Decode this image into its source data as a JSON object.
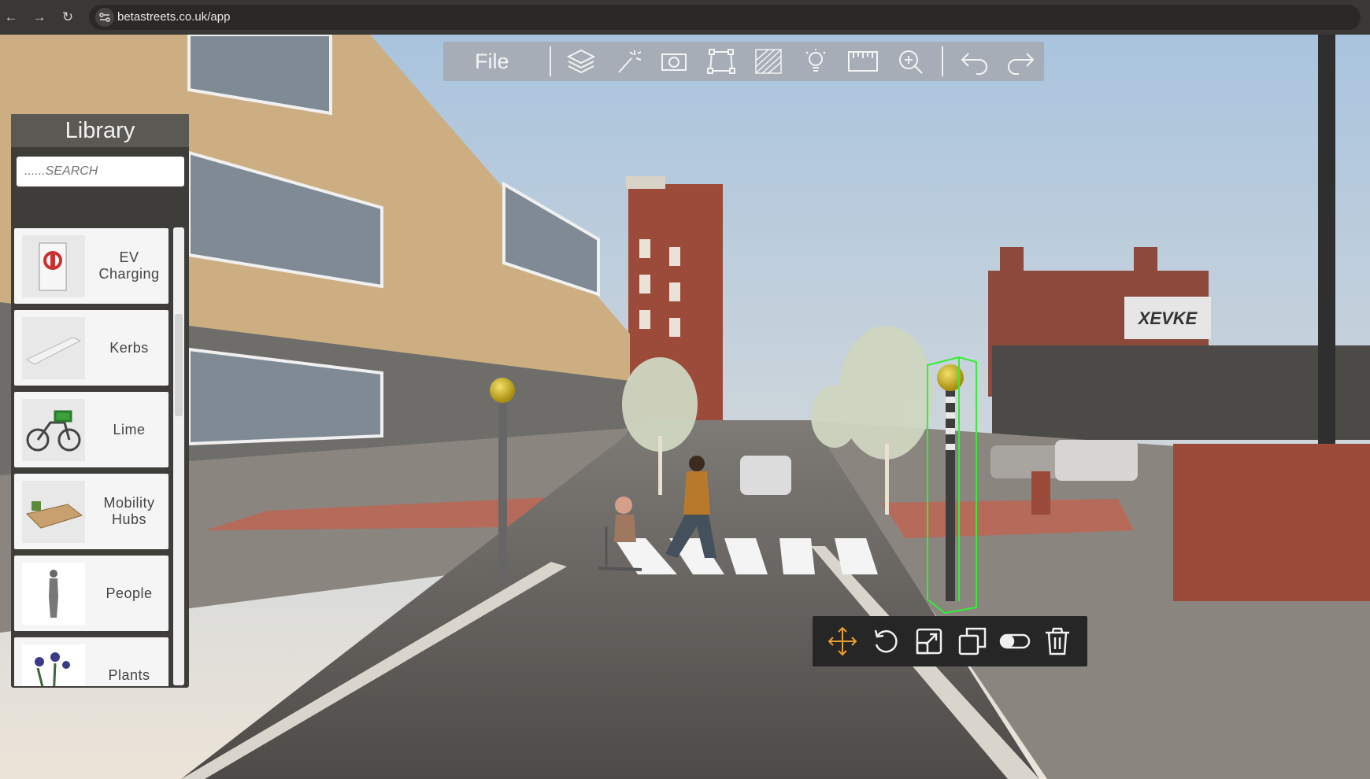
{
  "browser": {
    "url": "betastreets.co.uk/app",
    "back_icon": "←",
    "forward_icon": "→",
    "reload_icon": "↻"
  },
  "toolbar": {
    "file_label": "File",
    "icons": [
      "layers-icon",
      "magic-wand-icon",
      "camera-icon",
      "transform-icon",
      "texture-icon",
      "lightbulb-icon",
      "ruler-icon",
      "zoom-in-icon",
      "undo-icon",
      "redo-icon"
    ]
  },
  "library": {
    "title": "Library",
    "search_placeholder": "......SEARCH",
    "items": [
      {
        "label": "EV Charging"
      },
      {
        "label": "Kerbs"
      },
      {
        "label": "Lime"
      },
      {
        "label": "Mobility Hubs"
      },
      {
        "label": "People"
      },
      {
        "label": "Plants"
      }
    ]
  },
  "object_toolbar": {
    "icons": [
      "move-icon",
      "rotate-icon",
      "scale-icon",
      "duplicate-icon",
      "toggle-icon",
      "delete-icon"
    ],
    "accent": "#e8a030"
  },
  "scene": {
    "billboard_text": "XEVKE"
  }
}
